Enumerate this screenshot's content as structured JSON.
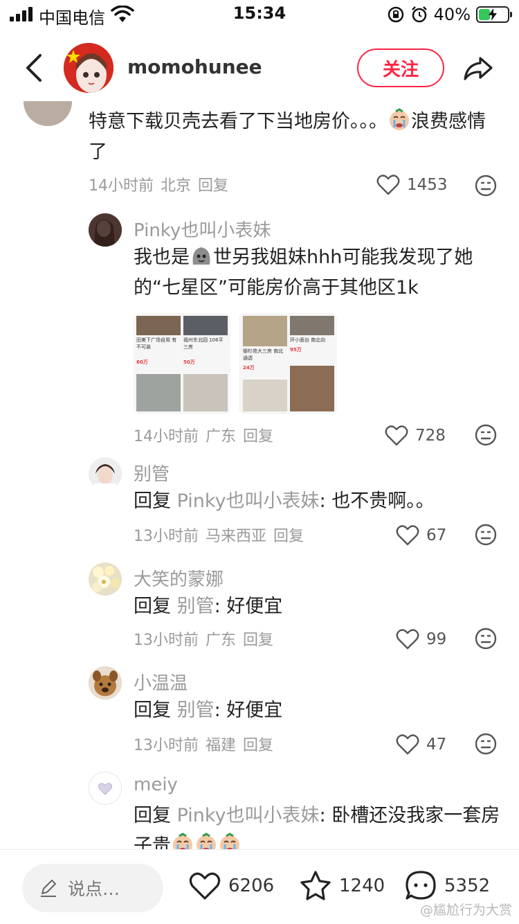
{
  "status_bar": {
    "carrier": "中国电信",
    "time": "15:34",
    "battery_percent": "40%",
    "battery_level": 0.4
  },
  "header": {
    "username": "momohunee",
    "follow_label": "关注"
  },
  "comments": [
    {
      "text": "特意下载贝壳去看了下当地房价。。。",
      "text_suffix": "浪费感情了",
      "time": "14小时前",
      "location": "北京",
      "reply_label": "回复",
      "likes": "1453"
    },
    {
      "name": "Pinky也叫小表妹",
      "text_prefix": "我也是",
      "text": "世另我姐妹hhh可能我发现了她的“七星区”可能房价高于其他区1k",
      "time": "14小时前",
      "location": "广东",
      "reply_label": "回复",
      "likes": "728"
    },
    {
      "name": "别管",
      "reply_prefix": "回复",
      "reply_to": "Pinky也叫小表妹",
      "text": ": 也不贵啊。。",
      "time": "13小时前",
      "location": "马来西亚",
      "reply_label": "回复",
      "likes": "67"
    },
    {
      "name": "大笑的蒙娜",
      "reply_prefix": "回复",
      "reply_to": "别管",
      "text": ": 好便宜",
      "time": "13小时前",
      "location": "广东",
      "reply_label": "回复",
      "likes": "99"
    },
    {
      "name": "小温温",
      "reply_prefix": "回复",
      "reply_to": "别管",
      "text": ": 好便宜",
      "time": "13小时前",
      "location": "福建",
      "reply_label": "回复",
      "likes": "47"
    },
    {
      "name": "meiy",
      "reply_prefix": "回复",
      "reply_to": "Pinky也叫小表妹",
      "text": ": 卧槽还没我家一套房子贵"
    }
  ],
  "listing_cards": {
    "shot1": [
      {
        "title": "田美下广场自用 有不可装",
        "price": "60万"
      },
      {
        "title": "福州东北园 106平三房",
        "price": "50万"
      }
    ],
    "shot2": [
      {
        "title": "银杉苑大三房 南北通透",
        "price": "24万"
      },
      {
        "title": "环小面台 南北向",
        "price": "95万"
      }
    ]
  },
  "bottom_bar": {
    "input_placeholder": "说点…",
    "likes": "6206",
    "favorites": "1240",
    "comments": "5352"
  },
  "watermark": "@尴尬行为大赏",
  "colors": {
    "accent": "#ff2442",
    "muted_text": "#9a9a9a",
    "battery_green": "#35c759"
  },
  "icons": [
    "back-icon",
    "share-icon",
    "heart-icon",
    "face-icon",
    "pencil-icon",
    "star-icon",
    "chat-icon",
    "wifi-icon",
    "lock-rotation-icon",
    "alarm-icon"
  ]
}
